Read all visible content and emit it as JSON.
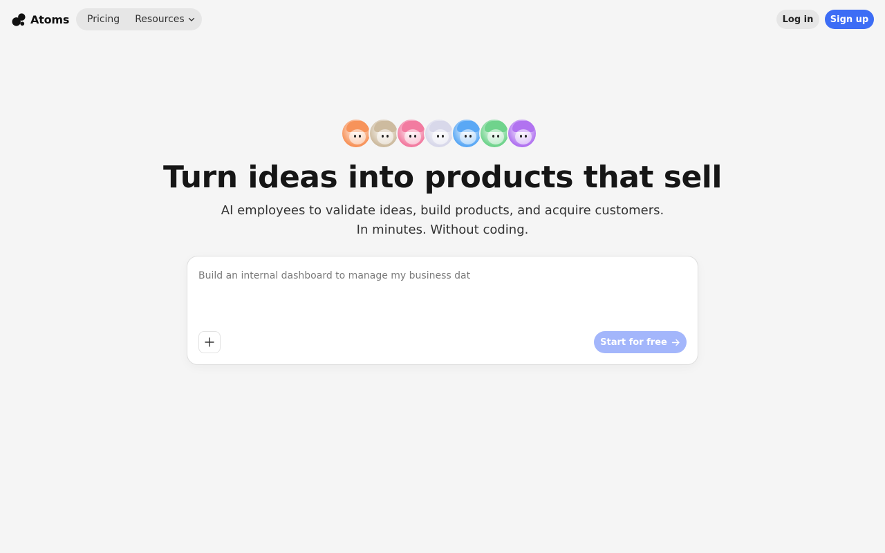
{
  "brand": {
    "name": "Atoms",
    "icon": "atoms-logo-icon"
  },
  "nav": {
    "pricing": "Pricing",
    "resources": "Resources"
  },
  "auth": {
    "login": "Log in",
    "signup": "Sign up"
  },
  "colors": {
    "accent": "#3d6df5",
    "accent_disabled": "#a3b6fb",
    "background": "#f5f5f5"
  },
  "hero": {
    "title": "Turn ideas into products that sell",
    "subtitle_line1": "AI employees to validate ideas, build products, and acquire customers.",
    "subtitle_line2": "In minutes. Without coding."
  },
  "avatars": [
    {
      "name": "avatar-orange",
      "color": "#f7935a"
    },
    {
      "name": "avatar-tan",
      "color": "#cdbb9f"
    },
    {
      "name": "avatar-pink",
      "color": "#f27ba0"
    },
    {
      "name": "avatar-white",
      "color": "#d8d8ea"
    },
    {
      "name": "avatar-blue",
      "color": "#5aa8f5"
    },
    {
      "name": "avatar-green",
      "color": "#6fd38c"
    },
    {
      "name": "avatar-purple",
      "color": "#b173f0"
    }
  ],
  "prompt": {
    "placeholder": "Build an internal dashboard to manage my business dat",
    "value": "",
    "attach_icon": "plus-icon",
    "submit_label": "Start for free",
    "submit_icon": "arrow-right-icon"
  }
}
